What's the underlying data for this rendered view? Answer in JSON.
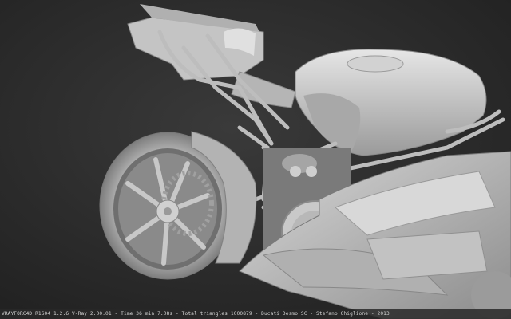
{
  "render": {
    "status_text": "VRAYFORC4D R1604 1.2.6 V-Ray 2.00.01 - Time 36 min 7.08s - Total triangles 1000879 - Ducati Desmo SC - Stefano Ghiglione - 2013",
    "background_color": "#2b2b2b",
    "model_color": "#c9c9c9"
  }
}
